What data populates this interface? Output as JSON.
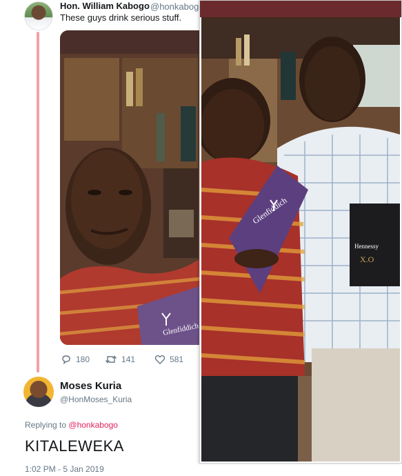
{
  "tweet": {
    "author_name": "Hon. William Kabogo",
    "author_handle": "@honkabogo",
    "text": "These guys drink serious stuff.",
    "stats": {
      "replies": "180",
      "retweets": "141",
      "likes": "581"
    }
  },
  "reply": {
    "author_name": "Moses Kuria",
    "author_handle": "@HonMoses_Kuria",
    "replying_prefix": "Replying to",
    "replying_to": "@honkabogo",
    "text": "KITALEWEKA",
    "timestamp": "1:02 PM - 5 Jan 2019"
  },
  "photo": {
    "box_left_brand": "Glenfiddich",
    "box_right_brand": "Hennessy",
    "box_right_sub": "X.O"
  },
  "colors": {
    "thread_line": "#f2a0a6",
    "mention": "#e0245e",
    "secondary_text": "#657786",
    "photo_frame": "#6b2b2e"
  },
  "icons": [
    "reply-icon",
    "retweet-icon",
    "like-icon"
  ]
}
